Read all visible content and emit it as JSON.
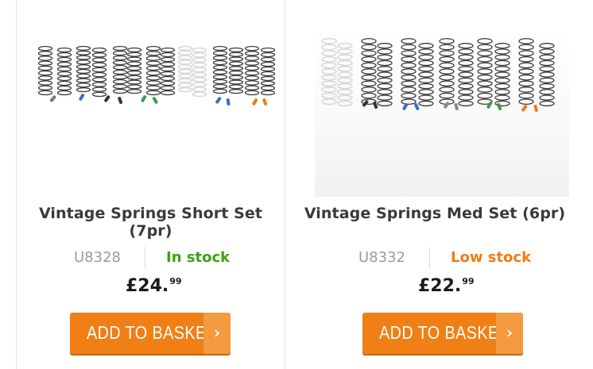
{
  "products": [
    {
      "title": "Vintage Springs Short Set (7pr)",
      "sku": "U8328",
      "stock": "In stock",
      "price_main": "£24.",
      "price_pence": "99",
      "button_label": "ADD TO BASKET",
      "button_arrow": "›",
      "image_icon": "springs-short-set-photo"
    },
    {
      "title": "Vintage Springs Med Set (6pr)",
      "sku": "U8332",
      "stock": "Low stock",
      "price_main": "£22.",
      "price_pence": "99",
      "button_label": "ADD TO BASKET",
      "button_arrow": "›",
      "image_icon": "springs-med-set-photo"
    }
  ],
  "colors": {
    "in_stock": "#3aa312",
    "low_stock": "#f07c13",
    "button": "#f07f15",
    "button_arrow_bg": "#f49a3f"
  }
}
